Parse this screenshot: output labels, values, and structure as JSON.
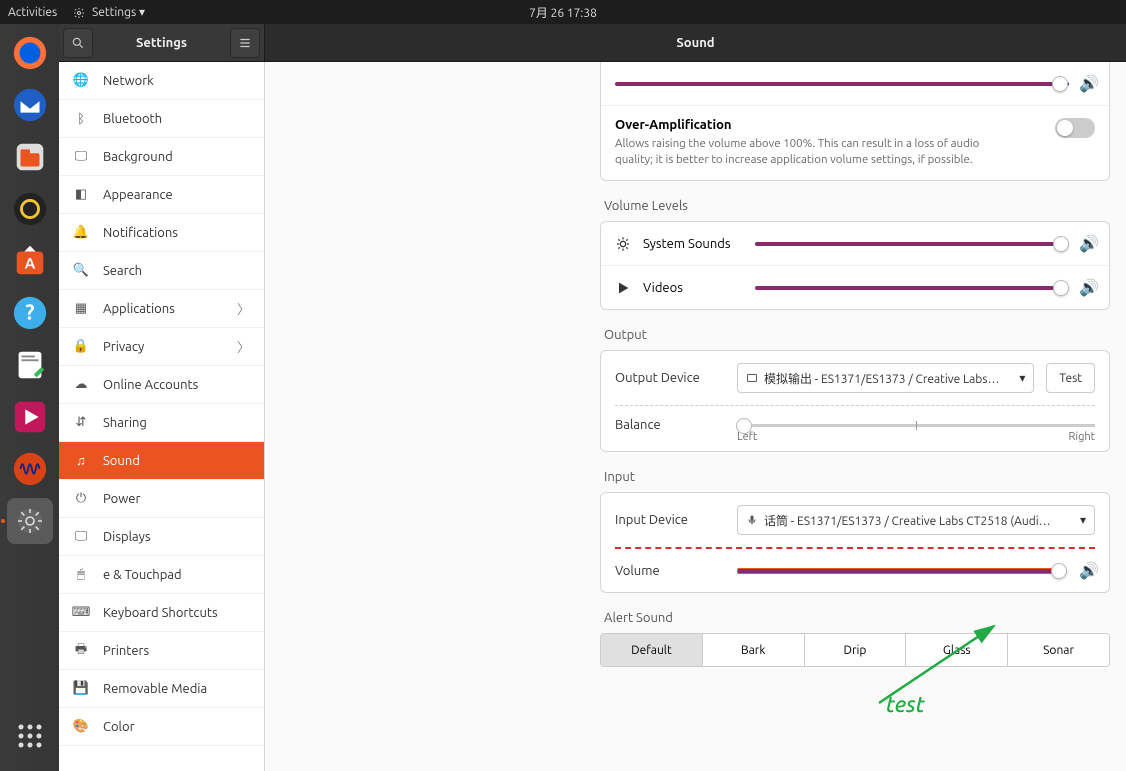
{
  "topbar": {
    "activities": "Activities",
    "app_menu": "Settings",
    "clock": "7月 26  17:38"
  },
  "dock": {
    "tooltip": "Settings"
  },
  "header": {
    "sidebar_title": "Settings",
    "page_title": "Sound"
  },
  "sidebar": {
    "items": [
      {
        "label": "Network"
      },
      {
        "label": "Bluetooth"
      },
      {
        "label": "Background"
      },
      {
        "label": "Appearance"
      },
      {
        "label": "Notifications"
      },
      {
        "label": "Search"
      },
      {
        "label": "Applications",
        "chevron": true
      },
      {
        "label": "Privacy",
        "chevron": true
      },
      {
        "label": "Online Accounts"
      },
      {
        "label": "Sharing"
      },
      {
        "label": "Sound",
        "selected": true
      },
      {
        "label": "Power"
      },
      {
        "label": "Displays"
      },
      {
        "label": "Keyboard Shortcuts"
      },
      {
        "label": "Printers"
      },
      {
        "label": "Removable Media"
      },
      {
        "label": "Color"
      }
    ],
    "mouse_trackpad_suffix": "e & Touchpad"
  },
  "sound": {
    "over_amp": {
      "title": "Over-Amplification",
      "desc": "Allows raising the volume above 100%. This can result in a loss of audio quality; it is better to increase application volume settings, if possible."
    },
    "volume_levels": {
      "title": "Volume Levels",
      "system_sounds": "System Sounds",
      "videos": "Videos"
    },
    "output": {
      "title": "Output",
      "device_label": "Output Device",
      "device_value": "模拟输出 - ES1371/ES1373 / Creative Labs…",
      "test_button": "Test",
      "balance_label": "Balance",
      "balance_left": "Left",
      "balance_right": "Right"
    },
    "input": {
      "title": "Input",
      "device_label": "Input Device",
      "device_value": "话筒 - ES1371/ES1373 / Creative Labs CT2518 (Audi…",
      "volume_label": "Volume"
    },
    "alert": {
      "title": "Alert Sound",
      "options": [
        "Default",
        "Bark",
        "Drip",
        "Glass",
        "Sonar"
      ]
    }
  },
  "annotation": {
    "label": "test"
  }
}
